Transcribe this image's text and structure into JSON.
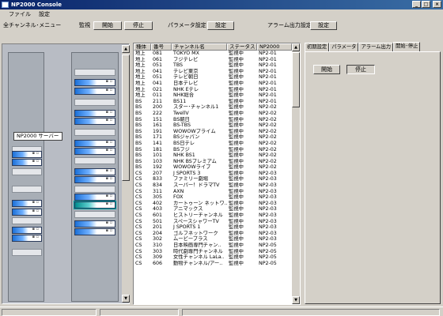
{
  "window": {
    "title": "NP2000 Console"
  },
  "menu": [
    "ファイル",
    "設定"
  ],
  "toolbar": {
    "all_channels_menu": "全チャンネル･メニュー",
    "monitor_label": "監視",
    "start_button": "開始",
    "stop_button": "停止",
    "param_settings_label": "パラメータ設定",
    "param_settings_button": "設定",
    "alarm_settings_label": "アラーム出力設定",
    "alarm_settings_button": "設定"
  },
  "left_panel": {
    "server_label": "NP2000 サーバー"
  },
  "table": {
    "columns": [
      "種体",
      "番号",
      "チャンネル名",
      "ステータス",
      "NP2000"
    ],
    "rows": [
      [
        "地上",
        "081",
        "TOKYO MX",
        "監視中",
        "NP2-01"
      ],
      [
        "地上",
        "061",
        "フジテレビ",
        "監視中",
        "NP2-01"
      ],
      [
        "地上",
        "051",
        "TBS",
        "監視中",
        "NP2-01"
      ],
      [
        "地上",
        "041",
        "テレビ東京",
        "監視中",
        "NP2-01"
      ],
      [
        "地上",
        "051",
        "テレビ朝日",
        "監視中",
        "NP2-01"
      ],
      [
        "地上",
        "041",
        "日本テレビ",
        "監視中",
        "NP2-01"
      ],
      [
        "地上",
        "021",
        "NHK Eテレ",
        "監視中",
        "NP2-01"
      ],
      [
        "地上",
        "011",
        "NHK総合",
        "監視中",
        "NP2-01"
      ],
      [
        "BS",
        "211",
        "BS11",
        "監視中",
        "NP2-01"
      ],
      [
        "BS",
        "200",
        "スター･チャンネル1",
        "監視中",
        "NP2-02"
      ],
      [
        "BS",
        "222",
        "TwellV",
        "監視中",
        "NP2-02"
      ],
      [
        "BS",
        "151",
        "BS朝日",
        "監視中",
        "NP2-02"
      ],
      [
        "BS",
        "161",
        "BS-TBS",
        "監視中",
        "NP2-02"
      ],
      [
        "BS",
        "191",
        "WOWOWプライム",
        "監視中",
        "NP2-02"
      ],
      [
        "BS",
        "171",
        "BSジャパン",
        "監視中",
        "NP2-02"
      ],
      [
        "BS",
        "141",
        "BS日テレ",
        "監視中",
        "NP2-02"
      ],
      [
        "BS",
        "181",
        "BSフジ",
        "監視中",
        "NP2-02"
      ],
      [
        "BS",
        "101",
        "NHK BS1",
        "監視中",
        "NP2-02"
      ],
      [
        "BS",
        "103",
        "NHK BSプレミアム",
        "監視中",
        "NP2-02"
      ],
      [
        "BS",
        "192",
        "WOWOWライブ",
        "監視中",
        "NP2-02"
      ],
      [
        "CS",
        "207",
        "J SPORTS 3",
        "監視中",
        "NP2-03"
      ],
      [
        "CS",
        "833",
        "ファミリー劇場",
        "監視中",
        "NP2-03"
      ],
      [
        "CS",
        "834",
        "スーパー！ドラマTV",
        "監視中",
        "NP2-03"
      ],
      [
        "CS",
        "311",
        "AXN",
        "監視中",
        "NP2-03"
      ],
      [
        "CS",
        "305",
        "FOX",
        "監視中",
        "NP2-03"
      ],
      [
        "CS",
        "402",
        "カートゥーン ネットワ..",
        "監視中",
        "NP2-03"
      ],
      [
        "CS",
        "403",
        "アニマックス",
        "監視中",
        "NP2-03"
      ],
      [
        "CS",
        "601",
        "ヒストリーチャンネル",
        "監視中",
        "NP2-03"
      ],
      [
        "CS",
        "501",
        "スペースシャワーTV",
        "監視中",
        "NP2-03"
      ],
      [
        "CS",
        "201",
        "J SPORTS 1",
        "監視中",
        "NP2-03"
      ],
      [
        "CS",
        "204",
        "ゴルフネットワーク",
        "監視中",
        "NP2-03"
      ],
      [
        "CS",
        "302",
        "ムービープラス",
        "監視中",
        "NP2-03"
      ],
      [
        "CS",
        "310",
        "日本映画専門チャン..",
        "監視中",
        "NP2-05"
      ],
      [
        "CS",
        "303",
        "時代劇専門チャンネル",
        "監視中",
        "NP2-05"
      ],
      [
        "CS",
        "309",
        "女性チャンネル LaLa..",
        "監視中",
        "NP2-05"
      ],
      [
        "CS",
        "606",
        "動物チャンネル/アー..",
        "監視中",
        "NP2-05"
      ]
    ]
  },
  "right_panel": {
    "tabs": [
      "初期設定",
      "パラメータ",
      "アラーム出力",
      "開始･停止"
    ],
    "active_tab": 3,
    "start_button": "開始",
    "stop_button": "停止"
  }
}
